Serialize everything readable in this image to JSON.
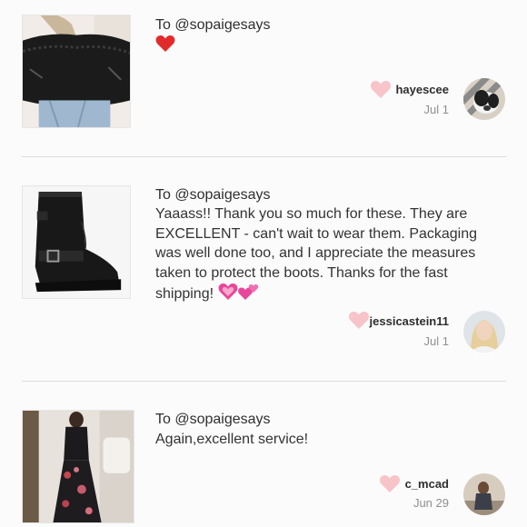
{
  "reviews": [
    {
      "to": "To @sopaigesays",
      "message": "",
      "emoji": "heart-red",
      "reviewer": "hayescee",
      "date": "Jul 1"
    },
    {
      "to": "To @sopaigesays",
      "message": "Yaaass!! Thank you so much for these. They are EXCELLENT - can't wait to wear them. Packaging was well done too, and I appreciate the measures taken to protect the boots. Thanks for the fast shipping!",
      "emoji": "hearts-pink",
      "reviewer": "jessicastein11",
      "date": "Jul 1"
    },
    {
      "to": "To @sopaigesays",
      "message": "Again,excellent service!",
      "emoji": "",
      "reviewer": "c_mcad",
      "date": "Jun 29"
    }
  ],
  "colors": {
    "like_heart": "#f7c4c9",
    "divider": "#dcdcdc",
    "date_text": "#8f8f8f"
  }
}
